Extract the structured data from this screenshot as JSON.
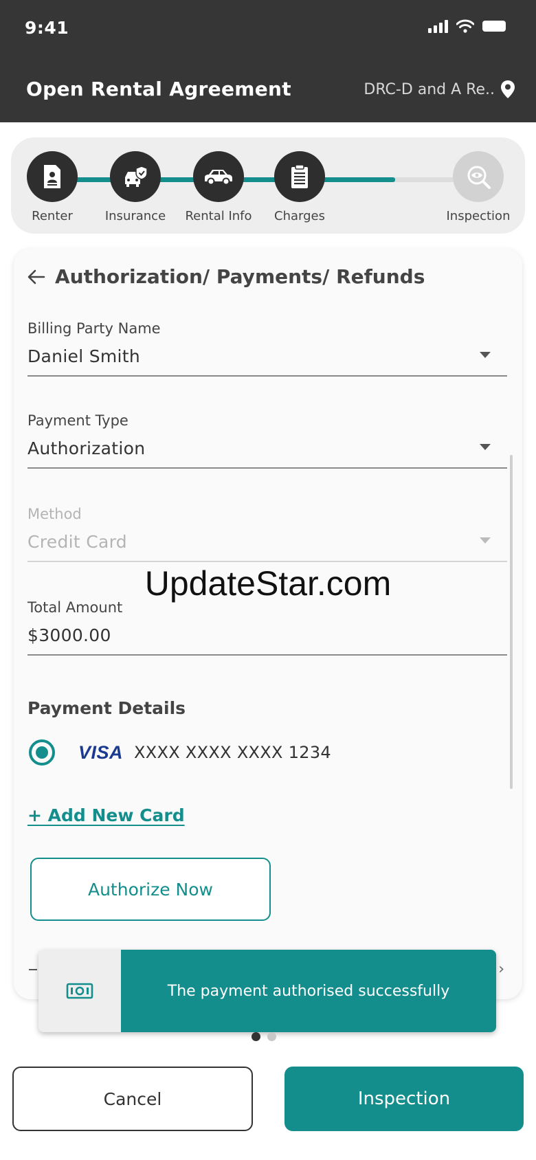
{
  "status_bar": {
    "time": "9:41"
  },
  "header": {
    "title": "Open Rental Agreement",
    "location": "DRC-D and A Re.."
  },
  "stepper": {
    "progress": 0.78,
    "steps": [
      {
        "label": "Renter",
        "icon": "document-person-icon",
        "active": true
      },
      {
        "label": "Insurance",
        "icon": "car-shield-icon",
        "active": true
      },
      {
        "label": "Rental Info",
        "icon": "car-icon",
        "active": true
      },
      {
        "label": "Charges",
        "icon": "clipboard-icon",
        "active": true
      },
      {
        "label": "Inspection",
        "icon": "eye-search-icon",
        "active": false
      }
    ]
  },
  "form": {
    "title": "Authorization/ Payments/ Refunds",
    "billing_party": {
      "label": "Billing Party Name",
      "value": "Daniel Smith"
    },
    "payment_type": {
      "label": "Payment Type",
      "value": "Authorization"
    },
    "method": {
      "label": "Method",
      "value": "Credit Card",
      "disabled": true
    },
    "total_amount": {
      "label": "Total Amount",
      "value": "$3000.00"
    },
    "payment_details": {
      "title": "Payment Details",
      "card_brand": "VISA",
      "card_number": "XXXX XXXX XXXX 1234",
      "selected": true
    },
    "add_card_label": "+ Add New Card",
    "authorize_label": "Authorize Now"
  },
  "toast": {
    "message": "The payment authorised successfully",
    "icon": "cash-icon"
  },
  "watermark": "UpdateStar.com",
  "pager": {
    "total": 2,
    "current": 1
  },
  "actions": {
    "cancel_label": "Cancel",
    "next_label": "Inspection"
  },
  "colors": {
    "accent": "#138e8c",
    "header_bg": "#363636"
  }
}
